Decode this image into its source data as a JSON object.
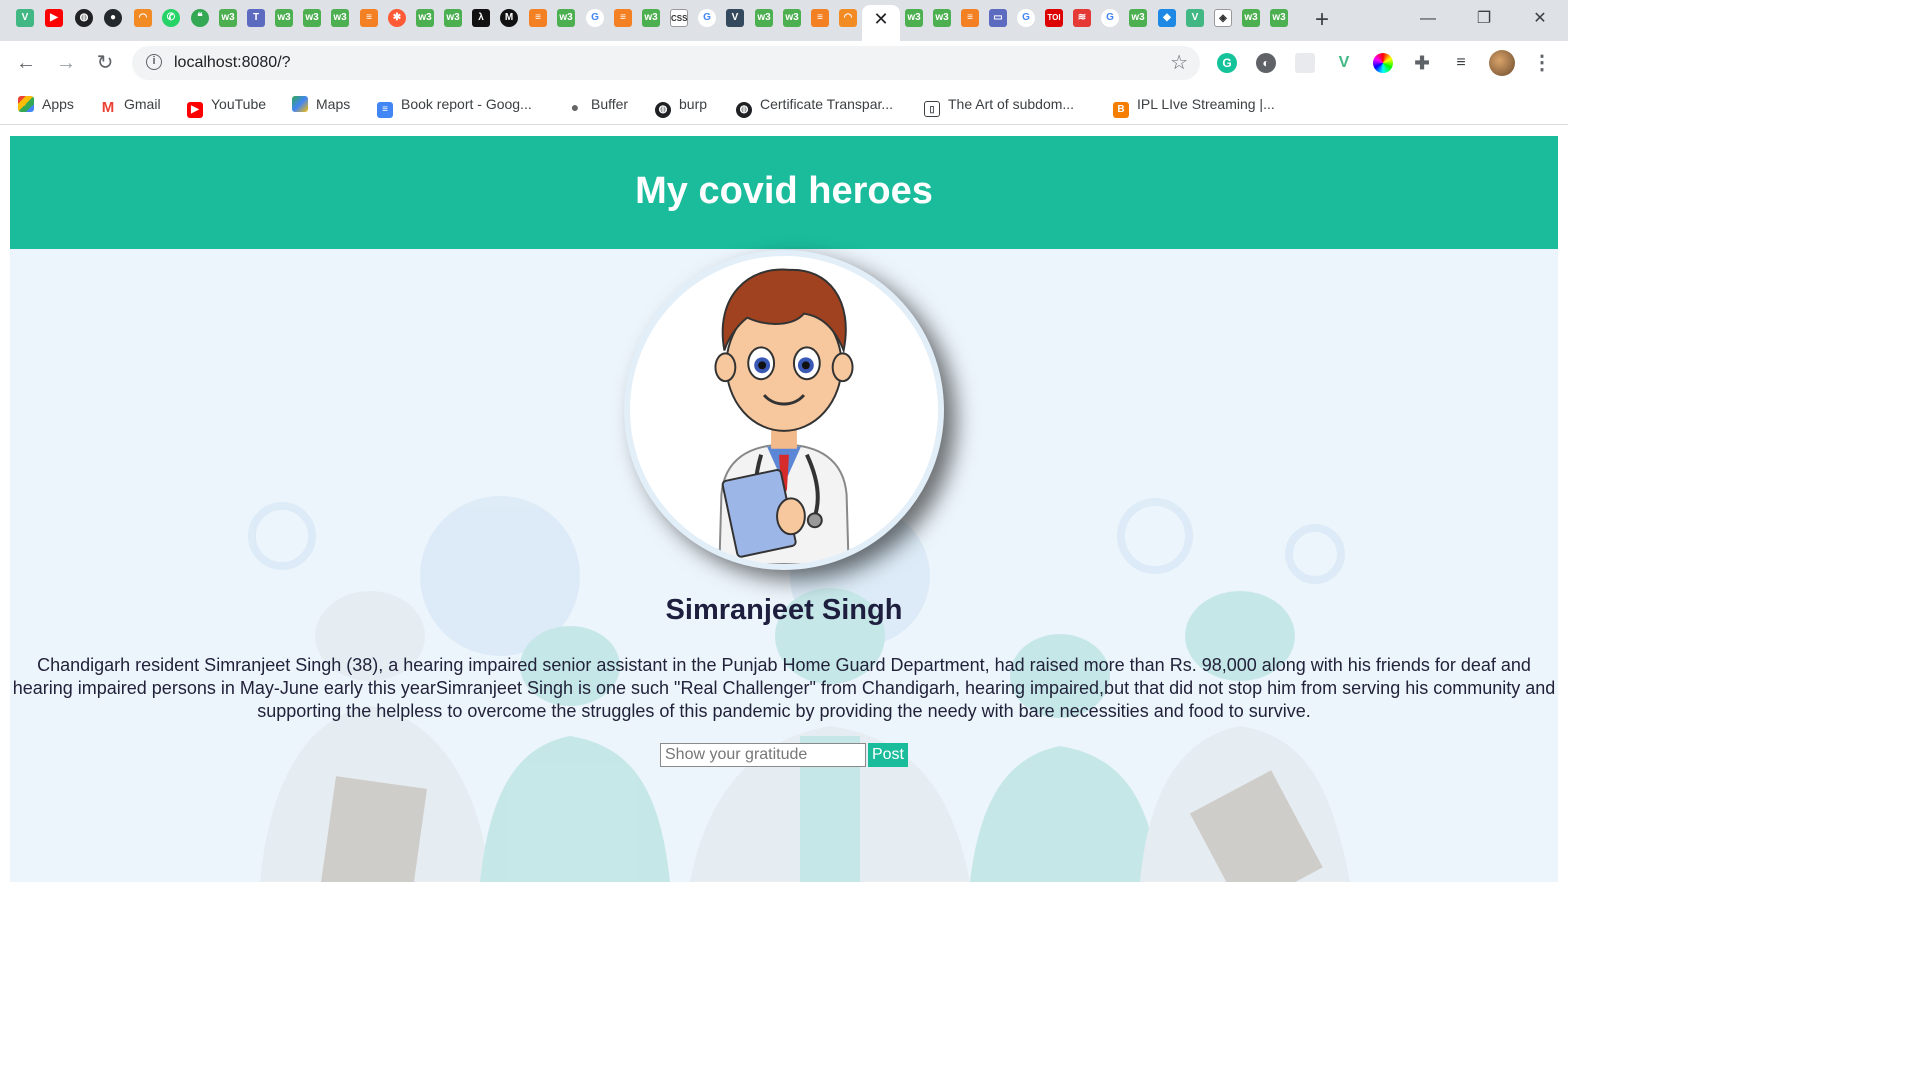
{
  "browser": {
    "new_tab_symbol": "+",
    "window_controls": {
      "minimize": "—",
      "restore": "❐",
      "close": "✕"
    },
    "active_tab_close": "✕",
    "url": "localhost:8080/?",
    "bookmarks": [
      {
        "label": "Apps",
        "icon": "apps-grid-icon",
        "color": "#4285f4"
      },
      {
        "label": "Gmail",
        "icon": "gmail-icon",
        "color": "#ea4335"
      },
      {
        "label": "YouTube",
        "icon": "youtube-icon",
        "color": "#ff0000"
      },
      {
        "label": "Maps",
        "icon": "maps-icon",
        "color": "#34a853"
      },
      {
        "label": "Book report - Goog...",
        "icon": "google-docs-icon",
        "color": "#4285f4"
      },
      {
        "label": "Buffer",
        "icon": "apple-icon",
        "color": "#555555"
      },
      {
        "label": "burp",
        "icon": "globe-icon",
        "color": "#202124"
      },
      {
        "label": "Certificate Transpar...",
        "icon": "globe-icon",
        "color": "#202124"
      },
      {
        "label": "The Art of subdom...",
        "icon": "book-icon",
        "color": "#3c4043"
      },
      {
        "label": "IPL LIve Streaming |...",
        "icon": "blogger-icon",
        "color": "#f57d00"
      }
    ]
  },
  "page": {
    "title": "My covid heroes",
    "hero": {
      "name": "Simranjeet Singh",
      "description": "Chandigarh resident Simranjeet Singh (38), a hearing impaired senior assistant in the Punjab Home Guard Department, had raised more than Rs. 98,000 along with his friends for deaf and hearing impaired persons in May-June early this yearSimranjeet Singh is one such \"Real Challenger\" from Chandigarh, hearing impaired,but that did not stop him from serving his community and supporting the helpless to overcome the struggles of this pandemic by providing the needy with bare necessities and food to survive."
    },
    "gratitude_placeholder": "Show your gratitude",
    "post_label": "Post",
    "colors": {
      "header": "#1abc9c",
      "background": "#edf5fc",
      "button": "#1abc9c"
    }
  }
}
